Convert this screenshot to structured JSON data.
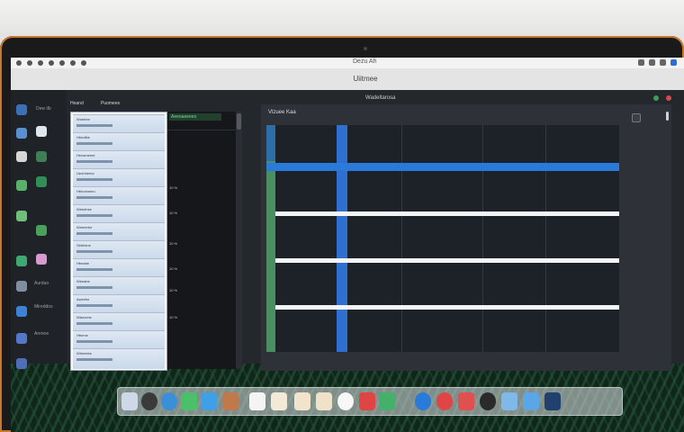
{
  "menubar": {
    "title": "Dezu Ah"
  },
  "window": {
    "title": "Uiitmee"
  },
  "sidebar_apps": [
    {
      "label": "Dew tlb",
      "icon": "app-icon"
    },
    {
      "label": "",
      "icon": "app-icon"
    },
    {
      "label": "",
      "icon": "app-icon"
    },
    {
      "label": "",
      "icon": "app-icon"
    },
    {
      "label": "",
      "icon": "app-icon"
    },
    {
      "label": "",
      "icon": "app-icon"
    },
    {
      "label": "",
      "icon": "app-icon"
    },
    {
      "label": "Aurdao",
      "icon": "app-icon"
    },
    {
      "label": "Mireddos",
      "icon": "app-icon"
    },
    {
      "label": "Arenoe",
      "icon": "app-icon"
    }
  ],
  "list_panel": {
    "headers": [
      "Heand",
      "Puomees"
    ],
    "rows": [
      "Wuebee",
      "Hhedlbe",
      "Heosmeeer",
      "Ueohheeor",
      "Hbhoeneeo",
      "Weeebse",
      "Wmeerbe",
      "Sbhbsne",
      "Hbeabe",
      "Weeabe",
      "Aweehe",
      "Wiseurbe",
      "Hbeme",
      "Wheeebs"
    ]
  },
  "mid_panel": {
    "header": "Aeeoaeeeeo",
    "labels": [
      "10 %",
      "10 %",
      "10 %",
      "10 %",
      "10 %",
      "10 %"
    ]
  },
  "grid_panel": {
    "title": "Wadeltarosa",
    "header": "Vlzuee  Kaa"
  },
  "colors": {
    "accent_blue": "#2a7ad9",
    "accent_green": "#4a8f62"
  },
  "dock_icons": [
    "finder-icon",
    "launchpad-icon",
    "safari-icon",
    "messages-icon",
    "mail-icon",
    "maps-icon",
    "photos-icon",
    "facetime-icon",
    "calendar-icon",
    "contacts-icon",
    "reminders-icon",
    "notes-icon",
    "music-icon",
    "podcasts-icon",
    "tv-icon",
    "news-icon",
    "appstore-icon",
    "settings-icon",
    "files-icon",
    "trash-icon"
  ]
}
